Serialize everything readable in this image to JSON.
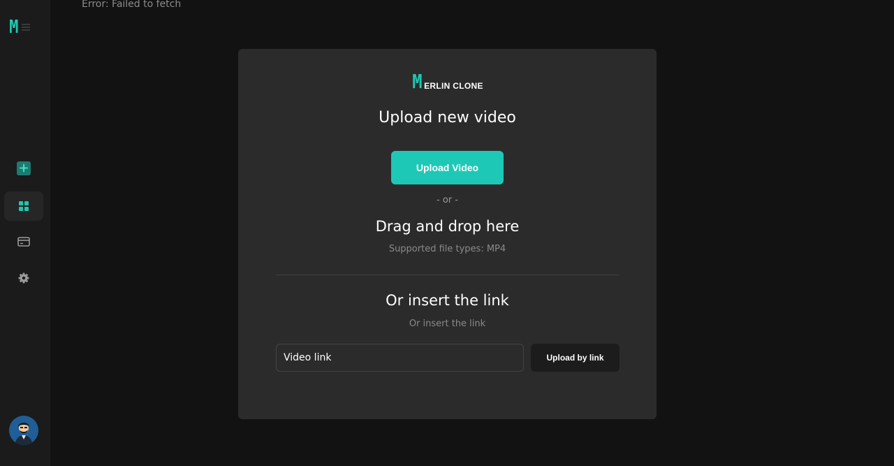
{
  "sidebar": {
    "logo_letter": "M",
    "items": [
      {
        "name": "create",
        "icon": "plus-square-icon"
      },
      {
        "name": "dashboard",
        "icon": "grid-icon",
        "active": true
      },
      {
        "name": "billing",
        "icon": "credit-card-icon"
      },
      {
        "name": "settings",
        "icon": "gear-icon"
      }
    ],
    "accent_color": "#1ec8b0"
  },
  "error": {
    "message": "Error: Failed to fetch"
  },
  "modal": {
    "brand": {
      "big": "M",
      "rest": "ERLIN CLONE"
    },
    "title": "Upload new video",
    "upload_button": "Upload Video",
    "or_text": "- or -",
    "drag_title": "Drag and drop here",
    "supported": "Supported file types: MP4",
    "link_title": "Or insert the link",
    "link_subtitle": "Or insert the link",
    "link_input": {
      "placeholder": "Video link",
      "value": ""
    },
    "link_button": "Upload by link"
  },
  "colors": {
    "accent": "#1ec8b7",
    "modal_bg": "#2b2b2b",
    "page_bg": "#121212"
  }
}
